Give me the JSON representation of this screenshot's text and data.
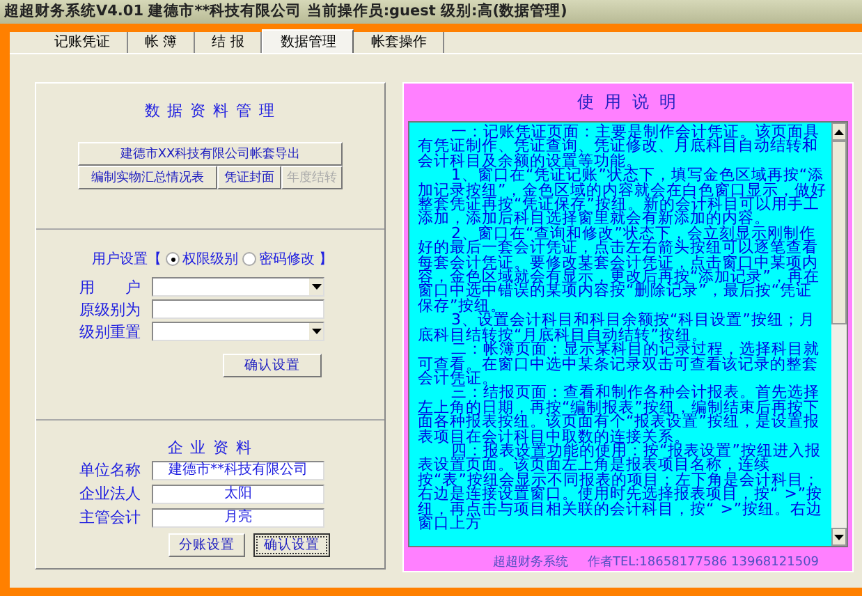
{
  "window": {
    "title": "超超财务系统V4.01  建德市**科技有限公司   当前操作员:guest   级别:高(数据管理)"
  },
  "tabs": [
    {
      "label": "记账凭证",
      "selected": false
    },
    {
      "label": "帐 簿",
      "selected": false
    },
    {
      "label": "结 报",
      "selected": false
    },
    {
      "label": "数据管理",
      "selected": true
    },
    {
      "label": "帐套操作",
      "selected": false
    }
  ],
  "data_management": {
    "heading": "数 据 资 料 管 理",
    "buttons": [
      [
        {
          "label": "建德市XX科技有限公司帐套导出",
          "disabled": false
        }
      ],
      [
        {
          "label": "编制实物汇总情况表",
          "disabled": false
        },
        {
          "label": "凭证封面",
          "disabled": false
        },
        {
          "label": "年度结转",
          "disabled": true
        }
      ]
    ]
  },
  "user_settings": {
    "label": "用户设置【",
    "close": "】",
    "options": [
      {
        "label": "权限级别",
        "selected": true
      },
      {
        "label": "密码修改",
        "selected": false
      }
    ],
    "fields": [
      {
        "label": "用　　户",
        "kind": "dropdown"
      },
      {
        "label": "原级别为",
        "kind": "text"
      },
      {
        "label": "级别重置",
        "kind": "dropdown"
      }
    ],
    "button": {
      "label": "确认设置",
      "focused": false
    }
  },
  "company": {
    "heading": "企 业 资 料",
    "fields": [
      {
        "label": "单位名称",
        "value": "建德市**科技有限公司"
      },
      {
        "label": "企业法人",
        "value": "太阳"
      },
      {
        "label": "主管会计",
        "value": "月亮"
      }
    ],
    "buttons": [
      {
        "label": "分账设置",
        "focused": false
      },
      {
        "label": "确认设置",
        "focused": true
      }
    ]
  },
  "help": {
    "heading": "使 用 说 明",
    "paragraphs": [
      "一：记账凭证页面：主要是制作会计凭证。该页面具有凭证制作、凭证查询、凭证修改、月底科目自动结转和会计科目及余额的设置等功能。",
      "1、窗口在“凭证记账”状态下，填写金色区域再按“添加记录按纽”，金色区域的内容就会在白色窗口显示，做好整套凭证再按“凭证保存”按纽。新的会计科目可以用手工添加，添加后科目选择窗里就会有新添加的内容。",
      "2、窗口在“查询和修改”状态下，会立刻显示刚制作好的最后一套会计凭证，点击左右箭头按纽可以逐笔查看每套会计凭证。要修改某套会计凭证，点击窗口中某项内容，金色区域就会有显示，更改后再按“添加记录”，再在窗口中选中错误的某项内容按“删除记录”，最后按“凭证保存”按纽。",
      "3、设置会计科目和科目余额按“科目设置”按纽；月底科目结转按“月底科目自动结转”按纽。",
      "二：帐簿页面：显示某科目的记录过程，选择科目就可查看。在窗口中选中某条记录双击可查看该记录的整套会计凭证。",
      "三：结报页面：查看和制作各种会计报表。首先选择左上角的日期，再按“编制报表”按纽，编制结束后再按下面各种报表按纽。该页面有个“报表设置”按纽，是设置报表项目在会计科目中取数的连接关系。",
      "四：报表设置功能的使用：按“报表设置”按纽进入报表设置页面。该页面左上角是报表项目名称，连续按“表”按纽会显示不同报表的项目；左下角是会计科目；右边是连接设置窗口。使用时先选择报表项目，按“ >”按纽，再点击与项目相关联的会计科目，按“ >”按纽。右边窗口上方"
    ],
    "footer_name": "超超财务系统",
    "footer_contact": "作者TEL:18658177586 13968121509"
  }
}
